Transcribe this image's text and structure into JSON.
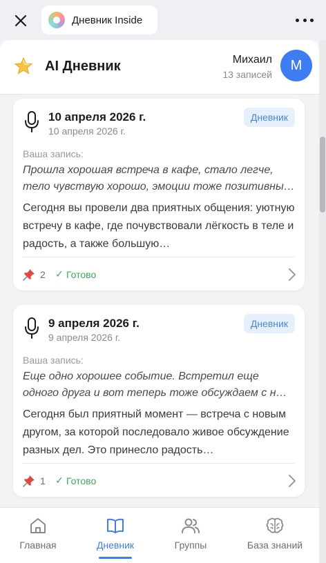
{
  "topbar": {
    "app_name": "Дневник Inside"
  },
  "header": {
    "title": "AI Дневник",
    "user_name": "Михаил",
    "entries_count": "13 записей",
    "avatar_initial": "M"
  },
  "entries": [
    {
      "title": "10 апреля 2026 г.",
      "date": "10 апреля 2026 г.",
      "badge": "Дневник",
      "entry_label": "Ваша запись:",
      "entry_text": "Прошла хорошая встреча в кафе, стало легче, тело чувствую хорошо, эмоции тоже позитивны…",
      "summary": "Сегодня вы провели два приятных общения: уютную встречу в кафе, где почувствовали лёгкость в теле и радость, а также большую…",
      "pins": "2",
      "status": "Готово"
    },
    {
      "title": "9 апреля 2026 г.",
      "date": "9 апреля 2026 г.",
      "badge": "Дневник",
      "entry_label": "Ваша запись:",
      "entry_text": "Еще одно хорошее событие. Встретил еще одного друга и вот теперь тоже обсуждаем с н…",
      "summary": "Сегодня был приятный момент — встреча с новым другом, за которой последовало живое обсуждение разных дел. Это принесло радость…",
      "pins": "1",
      "status": "Готово"
    }
  ],
  "tabbar": {
    "tabs": [
      {
        "label": "Главная",
        "icon": "home-icon"
      },
      {
        "label": "Дневник",
        "icon": "book-icon"
      },
      {
        "label": "Группы",
        "icon": "users-icon"
      },
      {
        "label": "База знаний",
        "icon": "brain-icon"
      }
    ],
    "active_index": 1
  },
  "colors": {
    "accent": "#3d7cf1",
    "badge_bg": "#e6f0fc",
    "badge_text": "#4a86d6",
    "status_green": "#3daa5c",
    "background": "#f2f3f5"
  }
}
